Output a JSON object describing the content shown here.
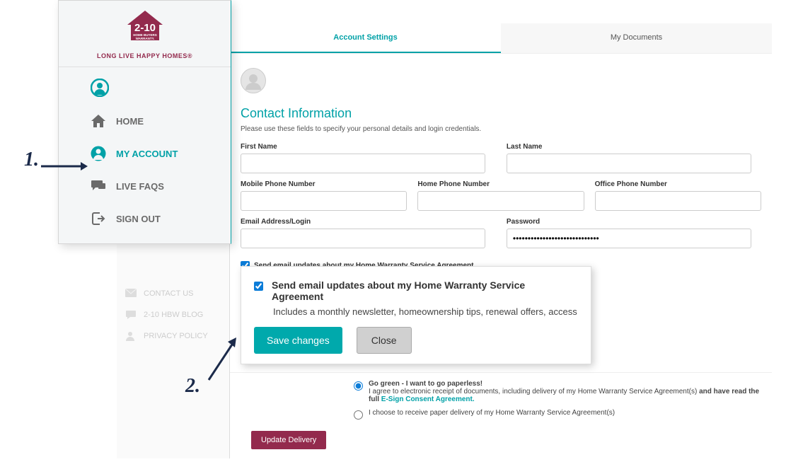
{
  "annotations": {
    "n1": "1.",
    "n2": "2."
  },
  "logo": {
    "tagline": "LONG LIVE HAPPY HOMES®"
  },
  "nav": {
    "home": "HOME",
    "my_account": "MY ACCOUNT",
    "live_faqs": "LIVE FAQS",
    "sign_out": "SIGN OUT"
  },
  "bgnav": {
    "contact_us": "CONTACT US",
    "blog": "2-10 HBW BLOG",
    "privacy": "PRIVACY POLICY"
  },
  "tabs": {
    "settings": "Account Settings",
    "docs": "My Documents"
  },
  "section": {
    "title": "Contact Information",
    "desc": "Please use these fields to specify your personal details and login credentials."
  },
  "labels": {
    "first_name": "First Name",
    "last_name": "Last Name",
    "mobile": "Mobile Phone Number",
    "home_phone": "Home Phone Number",
    "office": "Office Phone Number",
    "email": "Email Address/Login",
    "password": "Password"
  },
  "password_value": "•••••••••••••••••••••••••••••",
  "checkbox_label": "Send email updates about my Home Warranty Service Agreement",
  "modal": {
    "title": "Send email updates about my Home Warranty Service Agreement",
    "sub": "Includes a monthly newsletter, homeownership tips, renewal offers, access",
    "save": "Save changes",
    "close": "Close"
  },
  "delivery": {
    "opt1_bold": "Go green - I want to go paperless!",
    "opt1_line": "I agree to electronic receipt of documents, including delivery of my Home Warranty Service Agreement(s) ",
    "opt1_mid_bold": "and have read the full ",
    "opt1_link": "E-Sign Consent Agreement.",
    "opt2": "I choose to receive paper delivery of my Home Warranty Service Agreement(s)",
    "button": "Update Delivery"
  }
}
